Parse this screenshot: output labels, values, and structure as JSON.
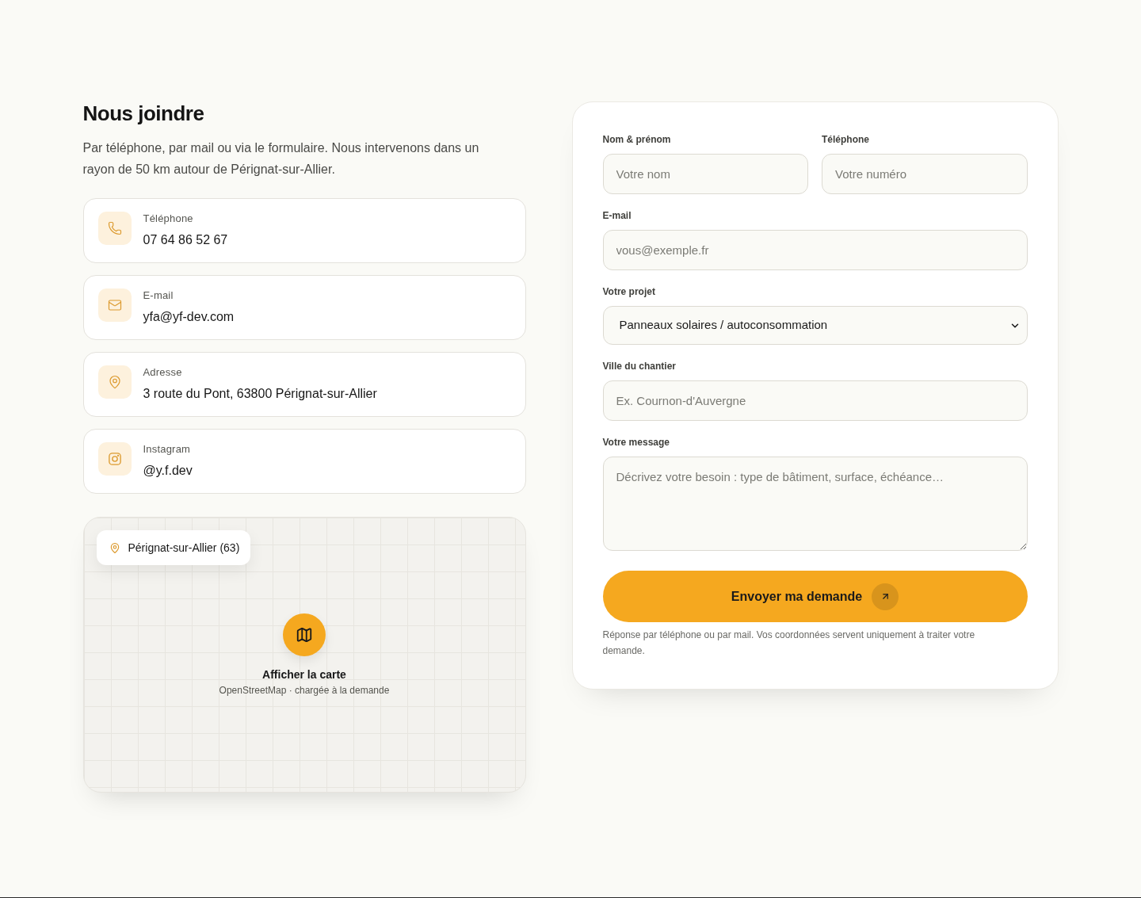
{
  "heading": "Nous joindre",
  "intro": "Par téléphone, par mail ou via le formulaire. Nous intervenons dans un rayon de 50 km autour de Pérignat-sur-Allier.",
  "contacts": [
    {
      "kind": "phone",
      "label": "Téléphone",
      "value": "07 64 86 52 67"
    },
    {
      "kind": "email",
      "label": "E-mail",
      "value": "yfa@yf-dev.com"
    },
    {
      "kind": "address",
      "label": "Adresse",
      "value": "3 route du Pont, 63800 Pérignat-sur-Allier"
    },
    {
      "kind": "instagram",
      "label": "Instagram",
      "value": "@y.f.dev"
    }
  ],
  "map": {
    "location": "Pérignat-sur-Allier (63)",
    "action": "Afficher la carte",
    "caption": "OpenStreetMap · chargée à la demande"
  },
  "form": {
    "rows": [
      [
        {
          "kind": "input",
          "label": "Nom & prénom",
          "placeholder": "Votre nom"
        },
        {
          "kind": "input",
          "label": "Téléphone",
          "placeholder": "Votre numéro"
        }
      ],
      [
        {
          "kind": "input",
          "label": "E-mail",
          "placeholder": "vous@exemple.fr"
        }
      ],
      [
        {
          "kind": "select",
          "label": "Votre projet",
          "value": "Panneaux solaires / autoconsommation"
        }
      ],
      [
        {
          "kind": "input",
          "label": "Ville du chantier",
          "placeholder": "Ex. Cournon-d'Auvergne"
        }
      ],
      [
        {
          "kind": "textarea",
          "label": "Votre message",
          "placeholder": "Décrivez votre besoin : type de bâtiment, surface, échéance…"
        }
      ]
    ],
    "submit": "Envoyer ma demande",
    "note": "Réponse par téléphone ou par mail. Vos coordonnées servent uniquement à traiter votre demande."
  }
}
